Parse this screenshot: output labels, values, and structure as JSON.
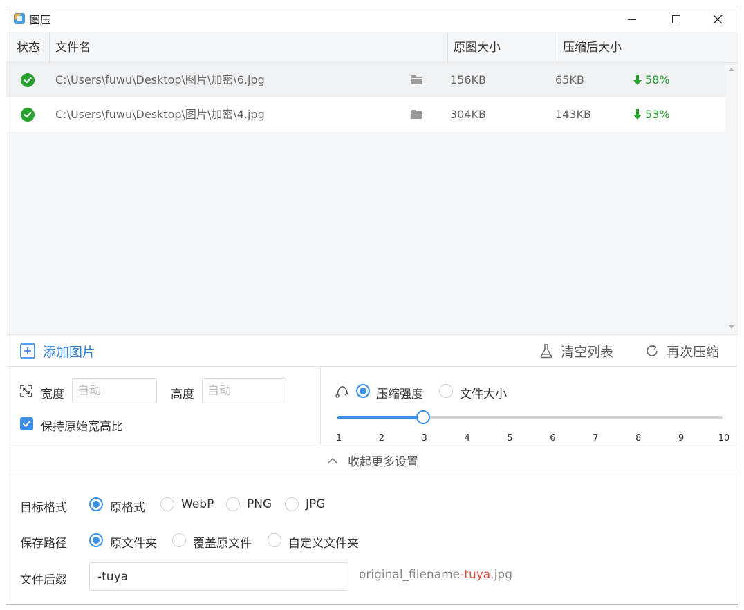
{
  "window": {
    "title": "图压"
  },
  "table": {
    "headers": {
      "status": "状态",
      "filename": "文件名",
      "original": "原图大小",
      "compressed": "压缩后大小"
    },
    "rows": [
      {
        "path": "C:\\Users\\fuwu\\Desktop\\图片\\加密\\6.jpg",
        "original": "156KB",
        "compressed": "65KB",
        "reduction": "58%"
      },
      {
        "path": "C:\\Users\\fuwu\\Desktop\\图片\\加密\\4.jpg",
        "original": "304KB",
        "compressed": "143KB",
        "reduction": "53%"
      }
    ]
  },
  "actions": {
    "add": "添加图片",
    "clear": "清空列表",
    "recompress": "再次压缩"
  },
  "resize": {
    "width_label": "宽度",
    "width_placeholder": "自动",
    "height_label": "高度",
    "height_placeholder": "自动",
    "keep_ratio": "保持原始宽高比",
    "keep_ratio_checked": true
  },
  "compression": {
    "mode_strength": "压缩强度",
    "mode_size": "文件大小",
    "selected_mode": "strength",
    "slider": {
      "min": 1,
      "max": 10,
      "value": 3,
      "ticks": [
        "1",
        "2",
        "3",
        "4",
        "5",
        "6",
        "7",
        "8",
        "9",
        "10"
      ]
    }
  },
  "collapse_label": "收起更多设置",
  "more": {
    "format_label": "目标格式",
    "formats": [
      "原格式",
      "WebP",
      "PNG",
      "JPG"
    ],
    "selected_format": "原格式",
    "path_label": "保存路径",
    "paths": [
      "原文件夹",
      "覆盖原文件",
      "自定义文件夹"
    ],
    "selected_path": "原文件夹",
    "suffix_label": "文件后缀",
    "suffix_value": "-tuya",
    "preview_prefix": "original_filename",
    "preview_suffix": "-tuya",
    "preview_ext": ".jpg"
  },
  "colors": {
    "accent": "#3b8fe6",
    "success": "#27a02e",
    "highlight": "#e54d42"
  }
}
